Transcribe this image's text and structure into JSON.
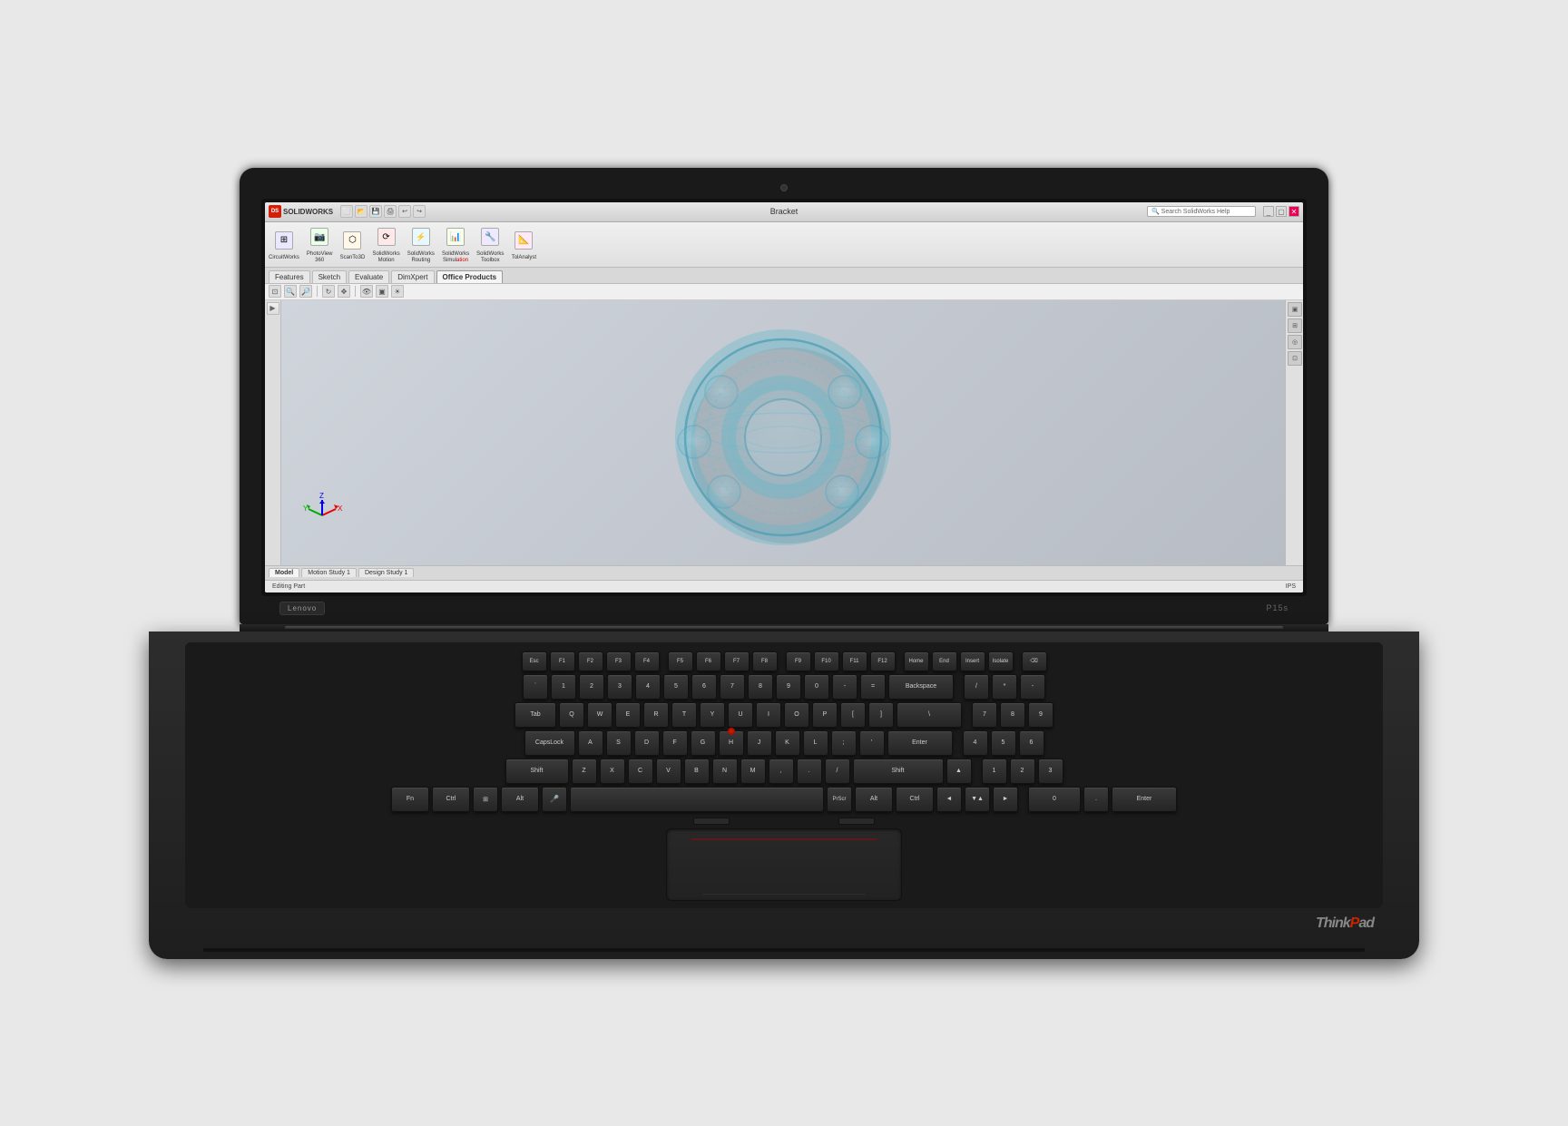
{
  "laptop": {
    "brand": "Lenovo",
    "model": "P15s",
    "thinkpad": "ThinkPad"
  },
  "screen": {
    "title": "Bracket",
    "software": "SOLIDWORKS",
    "tabs": {
      "menu": [
        "Features",
        "Sketch",
        "Evaluate",
        "DimXpert",
        "Office Products"
      ],
      "active": "Office Products"
    },
    "ribbon_groups": [
      {
        "label": "CircuitWorks",
        "icon": "⊞"
      },
      {
        "label": "PhotoView\n360",
        "icon": "📷"
      },
      {
        "label": "ScanTo3D",
        "icon": "⬡"
      },
      {
        "label": "SolidWorks\nMotion",
        "icon": "⟳"
      },
      {
        "label": "SolidWorks\nRouting",
        "icon": "🔌"
      },
      {
        "label": "SolidWorks\nSimulation",
        "icon": "⚡"
      },
      {
        "label": "SolidWorks\nToolbox",
        "icon": "🔧"
      },
      {
        "label": "TolAnalyst",
        "icon": "📐"
      }
    ],
    "bottom_tabs": [
      "Model",
      "Motion Study 1",
      "Design Study 1"
    ],
    "active_bottom_tab": "Model",
    "status": "Editing Part",
    "status_right": "IPS"
  },
  "keyboard": {
    "rows": [
      [
        "Esc",
        "F1",
        "F2",
        "F3",
        "F4",
        "F5",
        "F6",
        "F7",
        "F8",
        "F9",
        "F10",
        "F11",
        "F12",
        "Del"
      ],
      [
        "`",
        "1",
        "2",
        "3",
        "4",
        "5",
        "6",
        "7",
        "8",
        "9",
        "0",
        "-",
        "=",
        "Backspace"
      ],
      [
        "Tab",
        "Q",
        "W",
        "E",
        "R",
        "T",
        "Y",
        "U",
        "I",
        "O",
        "P",
        "[",
        "]",
        "\\"
      ],
      [
        "CapsLock",
        "A",
        "S",
        "D",
        "F",
        "G",
        "H",
        "J",
        "K",
        "L",
        ";",
        "'",
        "Enter"
      ],
      [
        "Shift",
        "Z",
        "X",
        "C",
        "V",
        "B",
        "N",
        "M",
        ",",
        ".",
        "/",
        "Shift"
      ],
      [
        "Fn",
        "Ctrl",
        "Win",
        "Alt",
        "",
        "Space",
        "",
        "Alt",
        "Ctrl",
        "◄",
        "▲▼",
        "►"
      ]
    ]
  }
}
